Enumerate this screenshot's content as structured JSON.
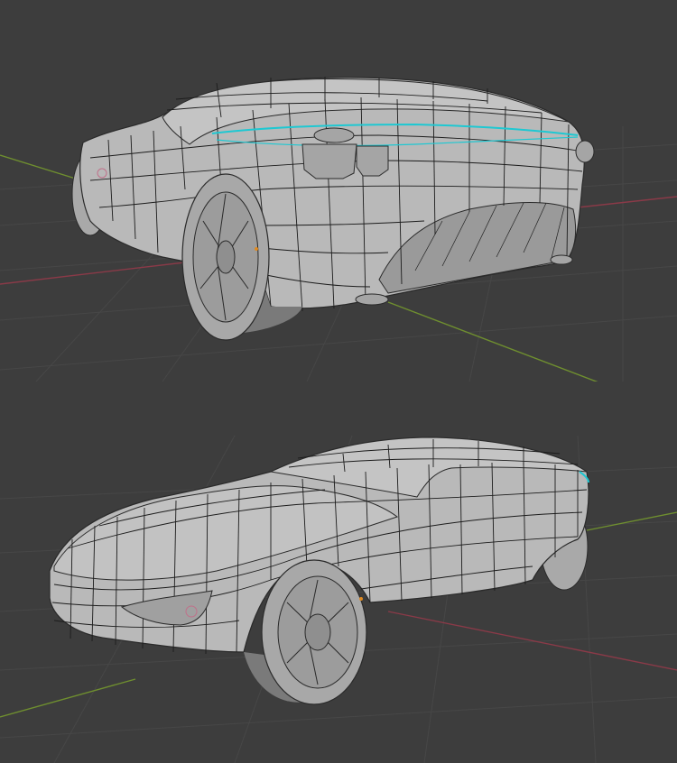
{
  "viewport": {
    "background_color": "#3d3d3d",
    "grid_color": "#474747",
    "x_axis_color": "#8a3a48",
    "y_axis_color": "#6f8f2f",
    "mesh_color": "#b9b9b9",
    "wire_color": "#1c1c1c",
    "selected_edge_color": "#1ec8d2",
    "object_origin_color": "#e08a20"
  },
  "views": [
    {
      "view": "rear-three-quarter",
      "object": "car-body-mesh"
    },
    {
      "view": "front-three-quarter",
      "object": "car-body-mesh"
    }
  ],
  "icons": [
    "object-origin-dot",
    "light-gizmo"
  ]
}
